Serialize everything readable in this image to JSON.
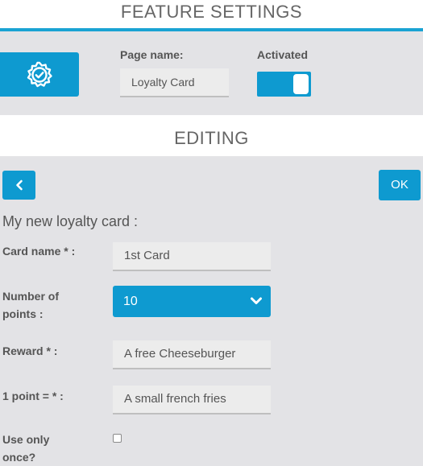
{
  "feature_settings": {
    "title": "FEATURE SETTINGS",
    "page_name_label": "Page name:",
    "page_name_value": "Loyalty Card",
    "activated_label": "Activated",
    "activated": true
  },
  "editing": {
    "title": "EDITING",
    "ok_label": "OK",
    "card_heading": "My new loyalty card :",
    "fields": {
      "card_name": {
        "label": "Card name * :",
        "value": "1st Card"
      },
      "points": {
        "label_line1": "Number of",
        "label_line2": "points :",
        "value": "10"
      },
      "reward": {
        "label": "Reward * :",
        "value": "A free Cheeseburger"
      },
      "point_value": {
        "label": "1 point = * :",
        "value": "A small french fries"
      },
      "use_once": {
        "label_line1": "Use only",
        "label_line2": "once?",
        "checked": false
      }
    }
  },
  "colors": {
    "accent": "#0e9ad0",
    "header_line": "#1aa3d3",
    "background": "#e3e3e6"
  },
  "icons": {
    "settings": "gear-check-icon",
    "back": "chevron-left-icon",
    "select": "chevron-down-icon"
  }
}
